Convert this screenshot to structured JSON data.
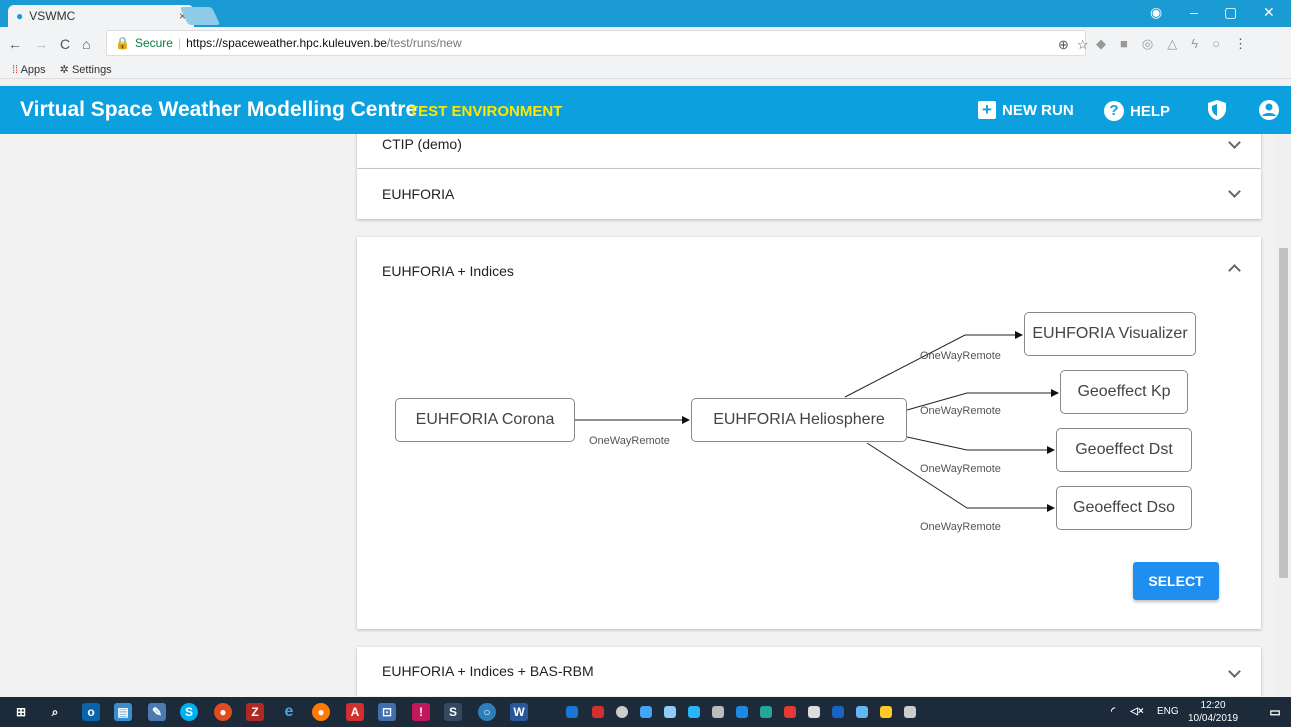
{
  "browser": {
    "tab_title": "VSWMC",
    "tab_close": "×",
    "secure_label": "Secure",
    "url_host": "https://spaceweather.hpc.kuleuven.be",
    "url_path": "/test/runs/new",
    "bookmarks": [
      "Apps",
      "Settings"
    ]
  },
  "header": {
    "title": "Virtual Space Weather Modelling Centre",
    "env": "TEST ENVIRONMENT",
    "new_run": "NEW RUN",
    "help": "HELP"
  },
  "panels": [
    {
      "label": "CTIP (demo)",
      "expanded": false
    },
    {
      "label": "EUHFORIA",
      "expanded": false
    },
    {
      "label": "EUHFORIA + Indices",
      "expanded": true
    },
    {
      "label": "EUHFORIA + Indices + BAS-RBM",
      "expanded": false
    }
  ],
  "diagram": {
    "nodes": {
      "corona": "EUHFORIA Corona",
      "helio": "EUHFORIA Heliosphere",
      "visualizer": "EUHFORIA Visualizer",
      "kp": "Geoeffect Kp",
      "dst": "Geoeffect Dst",
      "dso": "Geoeffect Dso"
    },
    "edge_label": "OneWayRemote"
  },
  "select_label": "SELECT",
  "taskbar": {
    "lang": "ENG",
    "time": "12:20",
    "date": "10/04/2019"
  }
}
